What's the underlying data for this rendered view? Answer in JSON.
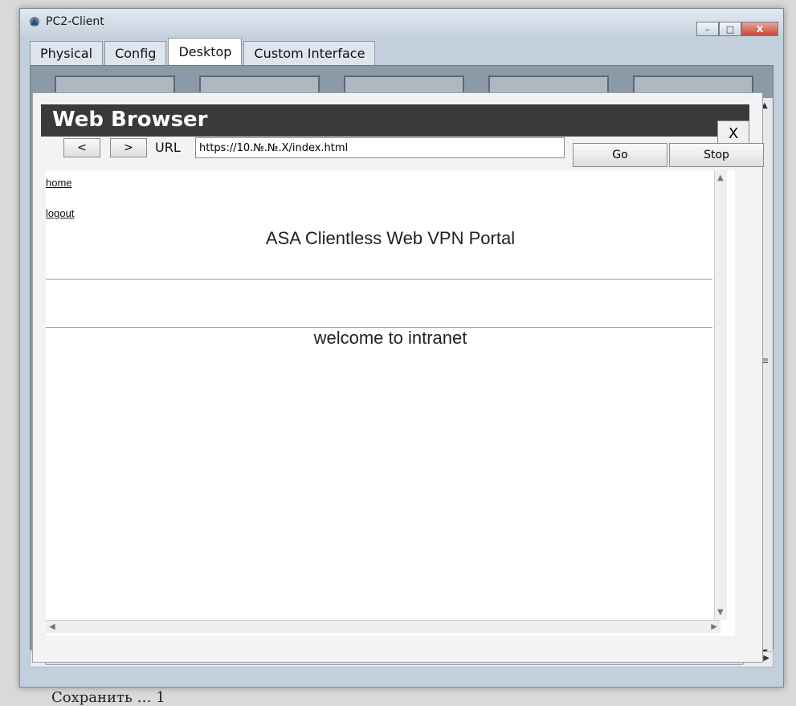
{
  "window": {
    "title": "PC2-Client",
    "min_glyph": "–",
    "max_glyph": "□",
    "close_glyph": "X"
  },
  "tabs": [
    {
      "label": "Physical"
    },
    {
      "label": "Config"
    },
    {
      "label": "Desktop"
    },
    {
      "label": "Custom Interface"
    }
  ],
  "browser": {
    "title": "Web Browser",
    "close_label": "X",
    "back_label": "<",
    "forward_label": ">",
    "url_label": "URL",
    "url_value": "https://10.№.№.X/index.html",
    "go_label": "Go",
    "stop_label": "Stop"
  },
  "page": {
    "links": [
      "home",
      "logout"
    ],
    "portal_title": "ASA Clientless Web VPN Portal",
    "welcome_text": "welcome to intranet"
  },
  "caption": "Сохранить … 1"
}
